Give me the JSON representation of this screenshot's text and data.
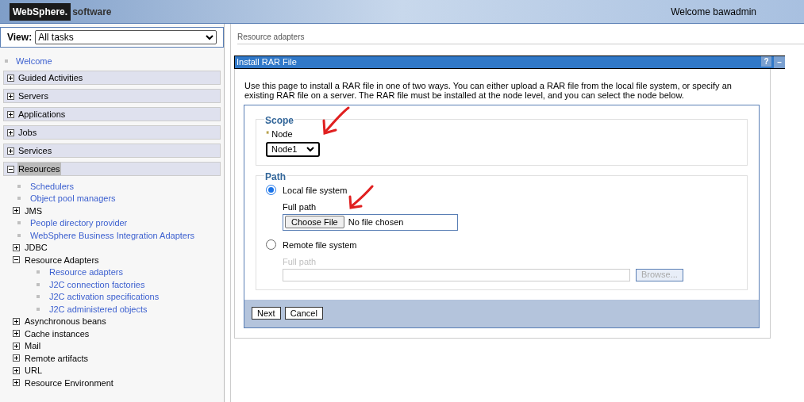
{
  "header": {
    "logo": "WebSphere.",
    "product": "software",
    "welcome": "Welcome bawadmin"
  },
  "view": {
    "label": "View:",
    "value": "All tasks"
  },
  "nav": [
    {
      "label": "Welcome",
      "kind": "link",
      "selected": false
    },
    {
      "label": "Guided Activities",
      "kind": "section",
      "expanded": false,
      "selected": false
    },
    {
      "label": "Servers",
      "kind": "section",
      "expanded": false,
      "selected": false
    },
    {
      "label": "Applications",
      "kind": "section",
      "expanded": false,
      "selected": false
    },
    {
      "label": "Jobs",
      "kind": "section",
      "expanded": false,
      "selected": false
    },
    {
      "label": "Services",
      "kind": "section",
      "expanded": false,
      "selected": false
    },
    {
      "label": "Resources",
      "kind": "section",
      "expanded": true,
      "selected": true,
      "children": [
        {
          "label": "Schedulers",
          "kind": "link"
        },
        {
          "label": "Object pool managers",
          "kind": "link"
        },
        {
          "label": "JMS",
          "kind": "group",
          "expanded": false
        },
        {
          "label": "People directory provider",
          "kind": "link"
        },
        {
          "label": "WebSphere Business Integration Adapters",
          "kind": "link"
        },
        {
          "label": "JDBC",
          "kind": "group",
          "expanded": false
        },
        {
          "label": "Resource Adapters",
          "kind": "group",
          "expanded": true,
          "children": [
            {
              "label": "Resource adapters",
              "kind": "link"
            },
            {
              "label": "J2C connection factories",
              "kind": "link"
            },
            {
              "label": "J2C activation specifications",
              "kind": "link"
            },
            {
              "label": "J2C administered objects",
              "kind": "link"
            }
          ]
        },
        {
          "label": "Asynchronous beans",
          "kind": "group",
          "expanded": false
        },
        {
          "label": "Cache instances",
          "kind": "group",
          "expanded": false
        },
        {
          "label": "Mail",
          "kind": "group",
          "expanded": false
        },
        {
          "label": "Remote artifacts",
          "kind": "group",
          "expanded": false
        },
        {
          "label": "URL",
          "kind": "group",
          "expanded": false
        },
        {
          "label": "Resource Environment",
          "kind": "group",
          "expanded": false
        }
      ]
    }
  ],
  "breadcrumb": "Resource adapters",
  "panel": {
    "title": "Install RAR File",
    "help": "?",
    "minimize": "–",
    "description": "Use this page to install a RAR file in one of two ways. You can either upload a RAR file from the local file system, or specify an existing RAR file on a server. The RAR file must be installed at the node level, and you can select the node below.",
    "scope": {
      "legend": "Scope",
      "required_mark": "*",
      "label": "Node",
      "value": "Node1"
    },
    "path": {
      "legend": "Path",
      "options": [
        {
          "label": "Local file system",
          "selected": true,
          "field_label": "Full path",
          "button": "Choose File",
          "value": "No file chosen"
        },
        {
          "label": "Remote file system",
          "selected": false,
          "field_label": "Full path",
          "button": "Browse..."
        }
      ]
    },
    "buttons": [
      "Next",
      "Cancel"
    ]
  }
}
